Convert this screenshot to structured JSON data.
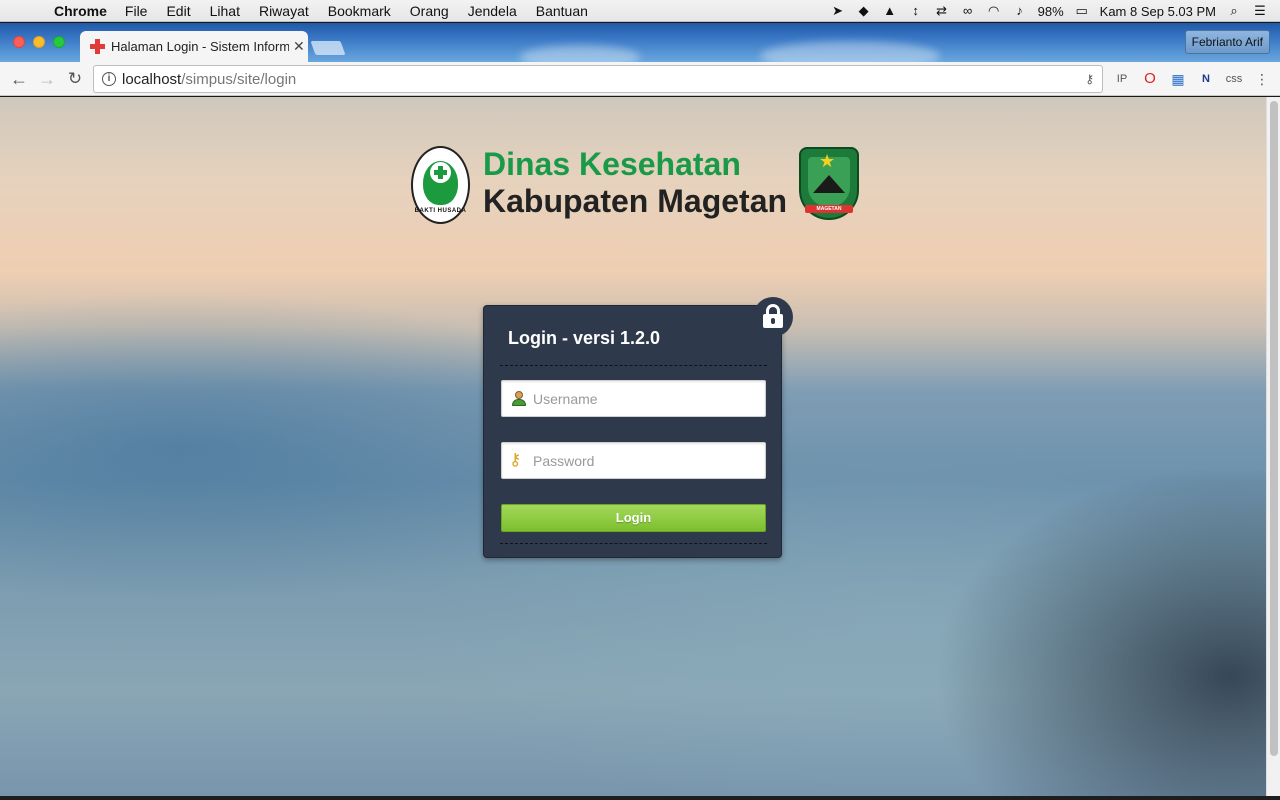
{
  "menubar": {
    "app_name": "Chrome",
    "items": [
      "File",
      "Edit",
      "Lihat",
      "Riwayat",
      "Bookmark",
      "Orang",
      "Jendela",
      "Bantuan"
    ],
    "battery": "98%",
    "datetime": "Kam 8 Sep  5.03 PM"
  },
  "browser": {
    "tab_title": "Halaman Login - Sistem Informasi",
    "profile_name": "Febrianto Arif",
    "url_host": "localhost",
    "url_path": "/simpus/site/login"
  },
  "header": {
    "line1": "Dinas Kesehatan",
    "line2": "Kabupaten Magetan",
    "left_logo_text": "BAKTI HUSADA",
    "right_logo_text": "MAGETAN"
  },
  "login": {
    "title": "Login - versi 1.2.0",
    "username_placeholder": "Username",
    "password_placeholder": "Password",
    "button_label": "Login"
  },
  "colors": {
    "heading_green": "#1a9a48",
    "panel_bg": "#2e3a4c",
    "button_green": "#8cc63f"
  }
}
